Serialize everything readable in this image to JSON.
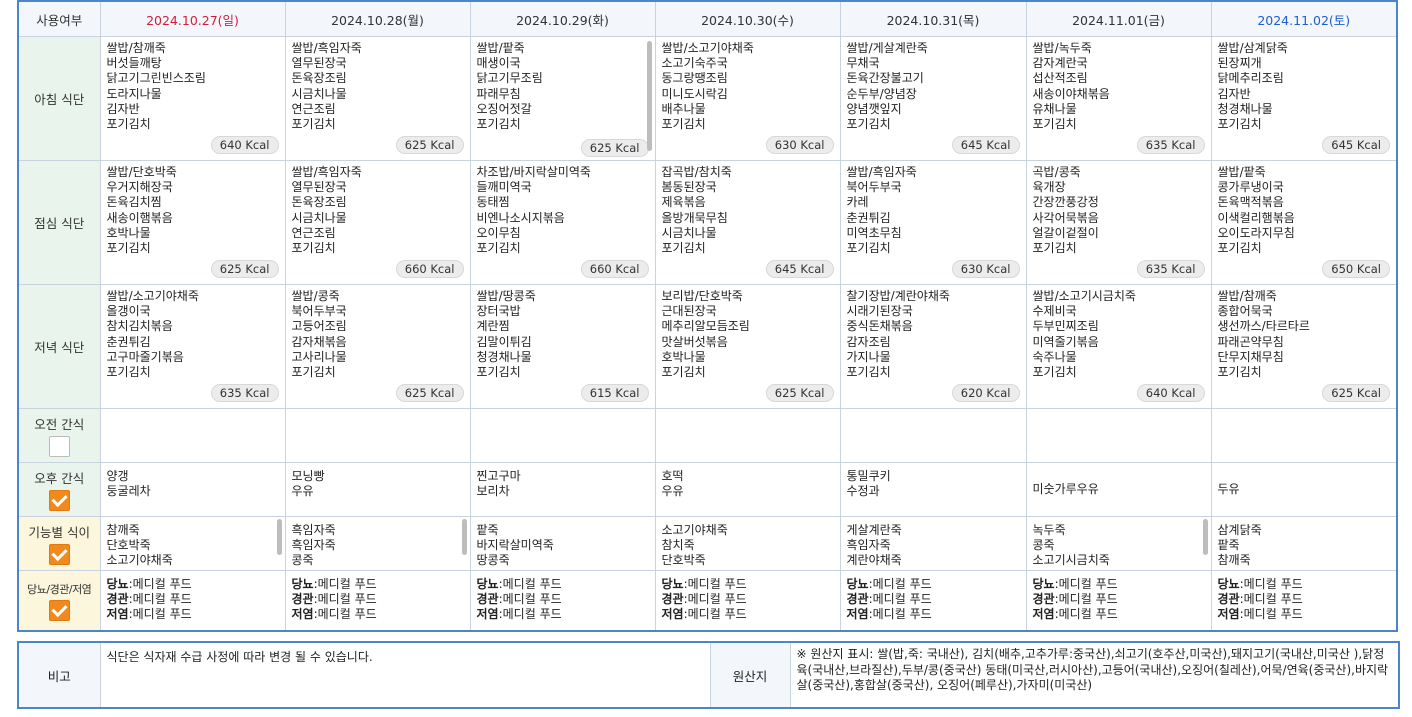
{
  "header": {
    "usage_label": "사용여부",
    "days": [
      {
        "date": "2024.10.27",
        "dow": "(일)",
        "type": "sun"
      },
      {
        "date": "2024.10.28",
        "dow": "(월)",
        "type": ""
      },
      {
        "date": "2024.10.29",
        "dow": "(화)",
        "type": ""
      },
      {
        "date": "2024.10.30",
        "dow": "(수)",
        "type": ""
      },
      {
        "date": "2024.10.31",
        "dow": "(목)",
        "type": ""
      },
      {
        "date": "2024.11.01",
        "dow": "(금)",
        "type": ""
      },
      {
        "date": "2024.11.02",
        "dow": "(토)",
        "type": "sat"
      }
    ]
  },
  "rows": {
    "breakfast_label": "아침 식단",
    "lunch_label": "점심 식단",
    "dinner_label": "저녁 식단",
    "am_snack_label": "오전 간식",
    "pm_snack_label": "오후 간식",
    "functional_label": "기능별 식이",
    "diet_label": "당뇨/경관/저염"
  },
  "checkboxes": {
    "am_snack": false,
    "pm_snack": true,
    "functional": true,
    "diet": true
  },
  "breakfast": [
    {
      "items": [
        "쌀밥/참깨죽",
        "버섯들깨탕",
        "닭고기그린빈스조림",
        "도라지나물",
        "김자반",
        "포기김치"
      ],
      "kcal": "640 Kcal"
    },
    {
      "items": [
        "쌀밥/흑임자죽",
        "열무된장국",
        "돈육장조림",
        "시금치나물",
        "연근조림",
        "포기김치"
      ],
      "kcal": "625 Kcal"
    },
    {
      "items": [
        "쌀밥/팥죽",
        "매생이국",
        "닭고기무조림",
        "파래무침",
        "오징어젓갈",
        "포기김치"
      ],
      "kcal": "625 Kcal"
    },
    {
      "items": [
        "쌀밥/소고기야채죽",
        "소고기숙주국",
        "동그랑땡조림",
        "미니도시락김",
        "배추나물",
        "포기김치"
      ],
      "kcal": "630 Kcal"
    },
    {
      "items": [
        "쌀밥/게살계란죽",
        "무채국",
        "돈육간장불고기",
        "순두부/양념장",
        "양념깻잎지",
        "포기김치"
      ],
      "kcal": "645 Kcal"
    },
    {
      "items": [
        "쌀밥/녹두죽",
        "감자계란국",
        "섭산적조림",
        "새송이야채볶음",
        "유채나물",
        "포기김치"
      ],
      "kcal": "635 Kcal"
    },
    {
      "items": [
        "쌀밥/삼계닭죽",
        "된장찌개",
        "닭메추리조림",
        "김자반",
        "청경채나물",
        "포기김치"
      ],
      "kcal": "645 Kcal"
    }
  ],
  "lunch": [
    {
      "items": [
        "쌀밥/단호박죽",
        "우거지해장국",
        "돈육김치찜",
        "새송이햄볶음",
        "호박나물",
        "포기김치"
      ],
      "kcal": "625 Kcal"
    },
    {
      "items": [
        "쌀밥/흑임자죽",
        "열무된장국",
        "돈육장조림",
        "시금치나물",
        "연근조림",
        "포기김치"
      ],
      "kcal": "660 Kcal"
    },
    {
      "items": [
        "차조밥/바지락살미역죽",
        "들깨미역국",
        "동태찜",
        "비엔나소시지볶음",
        "오이무침",
        "포기김치"
      ],
      "kcal": "660 Kcal"
    },
    {
      "items": [
        "잡곡밥/참치죽",
        "봄동된장국",
        "제육볶음",
        "올방개묵무침",
        "시금치나물",
        "포기김치"
      ],
      "kcal": "645 Kcal"
    },
    {
      "items": [
        "쌀밥/흑임자죽",
        "북어두부국",
        "카레",
        "춘권튀김",
        "미역초무침",
        "포기김치"
      ],
      "kcal": "630 Kcal"
    },
    {
      "items": [
        "곡밥/콩죽",
        "육개장",
        "간장깐풍강정",
        "사각어묵볶음",
        "얼갈이겉절이",
        "포기김치"
      ],
      "kcal": "635 Kcal"
    },
    {
      "items": [
        "쌀밥/팥죽",
        "콩가루냉이국",
        "돈육맥적볶음",
        "이색컬리햄볶음",
        "오이도라지무침",
        "포기김치"
      ],
      "kcal": "650 Kcal"
    }
  ],
  "dinner": [
    {
      "items": [
        "쌀밥/소고기야채죽",
        "올갱이국",
        "참치김치볶음",
        "춘권튀김",
        "고구마줄기볶음",
        "포기김치"
      ],
      "kcal": "635 Kcal"
    },
    {
      "items": [
        "쌀밥/콩죽",
        "북어두부국",
        "고등어조림",
        "감자채볶음",
        "고사리나물",
        "포기김치"
      ],
      "kcal": "625 Kcal"
    },
    {
      "items": [
        "쌀밥/땅콩죽",
        "장터국밥",
        "계란찜",
        "김말이튀김",
        "청경채나물",
        "포기김치"
      ],
      "kcal": "615 Kcal"
    },
    {
      "items": [
        "보리밥/단호박죽",
        "근대된장국",
        "메추리알모듬조림",
        "맛살버섯볶음",
        "호박나물",
        "포기김치"
      ],
      "kcal": "625 Kcal"
    },
    {
      "items": [
        "찰기장밥/계란야채죽",
        "시래기된장국",
        "중식돈채볶음",
        "감자조림",
        "가지나물",
        "포기김치"
      ],
      "kcal": "620 Kcal"
    },
    {
      "items": [
        "쌀밥/소고기시금치죽",
        "수제비국",
        "두부민찌조림",
        "미역줄기볶음",
        "숙주나물",
        "포기김치"
      ],
      "kcal": "640 Kcal"
    },
    {
      "items": [
        "쌀밥/참깨죽",
        "종합어묵국",
        "생선까스/타르타르",
        "파래곤약무침",
        "단무지채무침",
        "포기김치"
      ],
      "kcal": "625 Kcal"
    }
  ],
  "am_snack": [
    "",
    "",
    "",
    "",
    "",
    "",
    ""
  ],
  "pm_snack": [
    [
      "양갱",
      "둥굴레차"
    ],
    [
      "모닝빵",
      "우유"
    ],
    [
      "찐고구마",
      "보리차"
    ],
    [
      "호떡",
      "우유"
    ],
    [
      "통밀쿠키",
      "수정과"
    ],
    [
      "미숫가루우유"
    ],
    [
      "두유"
    ]
  ],
  "functional": [
    [
      "참깨죽",
      "단호박죽",
      "소고기야채죽"
    ],
    [
      "흑임자죽",
      "흑임자죽",
      "콩죽"
    ],
    [
      "팥죽",
      "바지락살미역죽",
      "땅콩죽"
    ],
    [
      "소고기야채죽",
      "참치죽",
      "단호박죽"
    ],
    [
      "게살계란죽",
      "흑임자죽",
      "계란야채죽"
    ],
    [
      "녹두죽",
      "콩죽",
      "소고기시금치죽"
    ],
    [
      "삼계닭죽",
      "팥죽",
      "참깨죽"
    ]
  ],
  "diet": {
    "diabetes_label": "당뇨",
    "tube_label": "경관",
    "lowsalt_label": "저염",
    "value": ":메디컬 푸드"
  },
  "notes": {
    "remark_label": "비고",
    "remark_text": "식단은 식자재 수급 사정에 따라 변경 될 수 있습니다.",
    "origin_label": "원산지",
    "origin_text": "※ 원산지 표시: 쌀(밥,죽: 국내산), 김치(배추,고추가루:중국산),쇠고기(호주산,미국산),돼지고기(국내산,미국산 ),닭정육(국내산,브라질산),두부/콩(중국산) 동태(미국산,러시아산),고등어(국내산),오징어(칠레산),어묵/연육(중국산),바지락살(중국산),홍합살(중국산), 오징어(페루산),가자미(미국산)"
  }
}
